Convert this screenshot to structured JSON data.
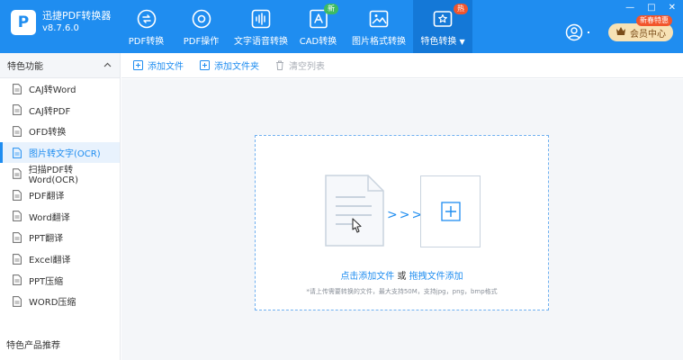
{
  "app": {
    "logo_letter": "P",
    "name": "迅捷PDF转换器",
    "version": "v8.7.6.0"
  },
  "nav": [
    {
      "label": "PDF转换",
      "icon": "pdf-convert-icon"
    },
    {
      "label": "PDF操作",
      "icon": "pdf-operate-icon"
    },
    {
      "label": "文字语音转换",
      "icon": "audio-wave-icon"
    },
    {
      "label": "CAD转换",
      "icon": "cad-icon",
      "badge": "新"
    },
    {
      "label": "图片格式转换",
      "icon": "image-icon"
    },
    {
      "label": "特色转换",
      "icon": "special-convert-icon",
      "badge": "热",
      "active": true
    }
  ],
  "header": {
    "vip_label": "会员中心",
    "vip_tag": "新春特惠"
  },
  "window_controls": {
    "minimize": "—",
    "maximize": "□",
    "close": "✕"
  },
  "sidebar": {
    "title": "特色功能",
    "items": [
      {
        "label": "CAJ转Word"
      },
      {
        "label": "CAJ转PDF"
      },
      {
        "label": "OFD转换"
      },
      {
        "label": "图片转文字(OCR)",
        "active": true
      },
      {
        "label": "扫描PDF转Word(OCR)"
      },
      {
        "label": "PDF翻译"
      },
      {
        "label": "Word翻译"
      },
      {
        "label": "PPT翻译"
      },
      {
        "label": "Excel翻译"
      },
      {
        "label": "PPT压缩"
      },
      {
        "label": "WORD压缩"
      }
    ],
    "footer": "特色产品推荐"
  },
  "toolbar": {
    "add_file": "添加文件",
    "add_folder": "添加文件夹",
    "clear_list": "清空列表"
  },
  "dropzone": {
    "text_click": "点击添加文件",
    "text_or": " 或 ",
    "text_drag": "拖拽文件添加",
    "hint": "*请上传需要转换的文件，最大支持50M，支持jpg，png，bmp格式"
  },
  "colors": {
    "primary": "#1f8df0",
    "active_nav": "#1478d7",
    "new_badge": "#3dbb62",
    "hot_badge": "#f2552c",
    "vip_bg": "#f7e2b5"
  }
}
